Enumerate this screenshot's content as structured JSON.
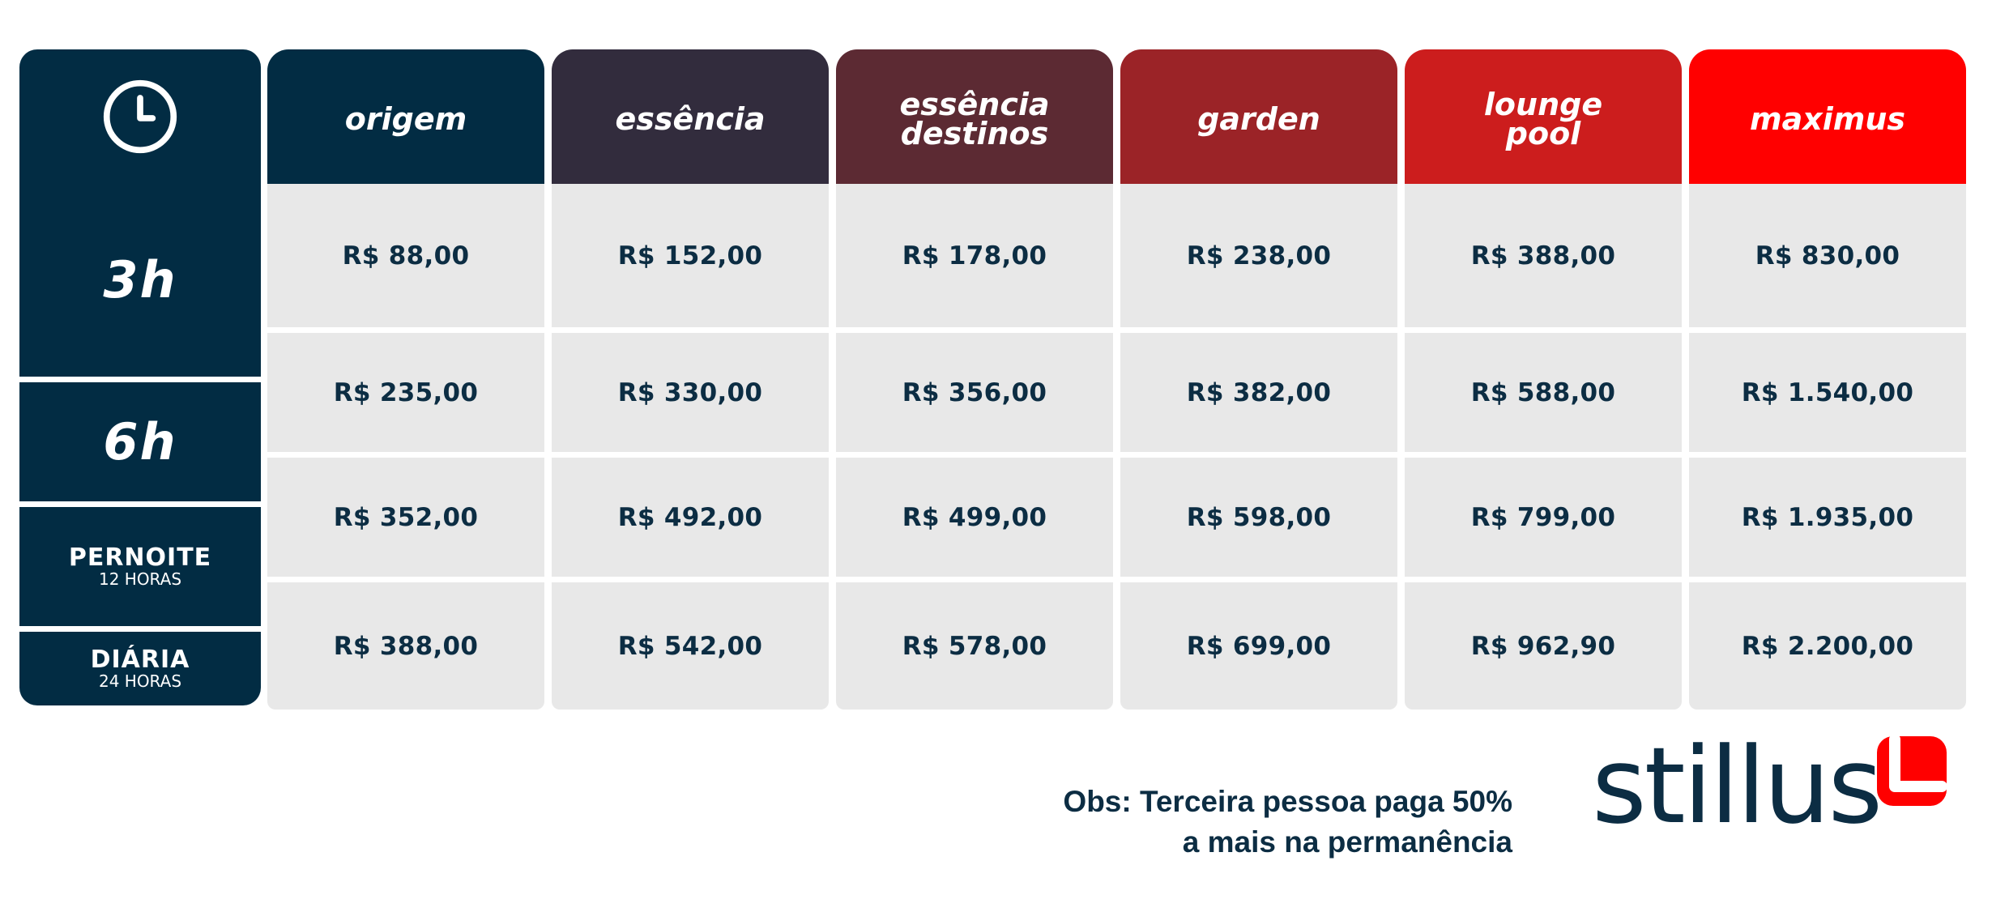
{
  "time_column": {
    "rows": [
      {
        "label": "3h",
        "sub": ""
      },
      {
        "label": "6h",
        "sub": ""
      },
      {
        "label": "PERNOITE",
        "sub": "12 HORAS"
      },
      {
        "label": "DIÁRIA",
        "sub": "24 HORAS"
      }
    ]
  },
  "categories": [
    {
      "name": "origem",
      "color": "#022c43"
    },
    {
      "name": "essência",
      "color": "#322c3d"
    },
    {
      "name": "essência\ndestinos",
      "color": "#5c2a33"
    },
    {
      "name": "garden",
      "color": "#9b2327"
    },
    {
      "name": "lounge\npool",
      "color": "#cc1d1d"
    },
    {
      "name": "maximus",
      "color": "#ff0000"
    }
  ],
  "prices": [
    [
      "R$ 88,00",
      "R$ 152,00",
      "R$ 178,00",
      "R$ 238,00",
      "R$ 388,00",
      "R$ 830,00"
    ],
    [
      "R$ 235,00",
      "R$ 330,00",
      "R$ 356,00",
      "R$ 382,00",
      "R$ 588,00",
      "R$ 1.540,00"
    ],
    [
      "R$ 352,00",
      "R$ 492,00",
      "R$ 499,00",
      "R$ 598,00",
      "R$ 799,00",
      "R$ 1.935,00"
    ],
    [
      "R$ 388,00",
      "R$ 542,00",
      "R$ 578,00",
      "R$ 699,00",
      "R$ 962,90",
      "R$ 2.200,00"
    ]
  ],
  "footer": {
    "obs_line1": "Obs: Terceira pessoa paga 50%",
    "obs_line2": "a mais na permanência"
  },
  "logo": {
    "text": "stillus",
    "mark_color": "#ff0000",
    "text_color": "#0c2d43"
  },
  "icons": {
    "header": "clock-icon",
    "logo": "stillus-logo-icon"
  }
}
